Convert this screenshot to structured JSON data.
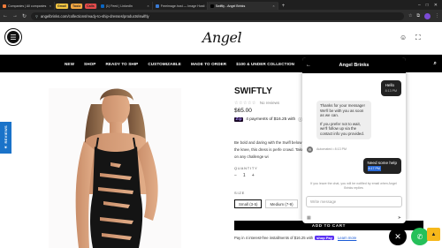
{
  "browser": {
    "tabs": [
      {
        "label": "Companies | All companies",
        "color": "#f07c3a",
        "active": false
      },
      {
        "label": "Gmail",
        "color": "#f4c542",
        "chip": true
      },
      {
        "label": "Toolz",
        "color": "#f4a742",
        "chip": true
      },
      {
        "label": "Calls",
        "color": "#e24a4a",
        "chip": true
      },
      {
        "label": "(1) Feed | LinkedIn",
        "color": "#0a66c2",
        "active": false
      },
      {
        "label": "Freeimage.host — Image Hosti",
        "color": "#3a7bd5",
        "active": false
      },
      {
        "label": "Swiftly - Angel Brinks",
        "color": "#000000",
        "active": true
      }
    ],
    "url": "angelbrinks.com/collections/ready-to-ship-dresses/products/swiftly"
  },
  "header": {
    "logo_text": "Angel Brinks",
    "menu_icon": "menu-icon",
    "user_icon": "user-icon",
    "cart_icon": "bag-icon"
  },
  "nav": {
    "items": [
      "NEW",
      "SHOP",
      "READY TO SHIP",
      "CUSTOMIZABLE",
      "MADE TO ORDER",
      "$100 & UNDER COLLECTION",
      "PLUS BAE"
    ]
  },
  "reviews_tab": {
    "label": "★ REVIEWS"
  },
  "product": {
    "title": "SWIFTLY",
    "stars": "☆☆☆☆☆",
    "reviews": "No reviews",
    "price": "$65.00",
    "zip_logo": "Zip",
    "zip_text": "4 payments of $16.25 with",
    "description": "Be bold and daring with the Swifl below the knee, this dress is perfe crowd. Take on any challenge wi",
    "quantity_label": "QUANTITY",
    "quantity": "1",
    "size_label": "SIZE",
    "sizes": [
      "Small (3-5)",
      "Medium (7-9)"
    ],
    "add_to_cart": "ADD TO CART",
    "shoppay_text": "Pay in 4 interest-free installments of $16.25 with",
    "shoppay_logo": "shop Pay",
    "learn_more": "Learn more"
  },
  "chat": {
    "title": "Angel Brinks",
    "messages": [
      {
        "from": "user",
        "text": "Hello",
        "time": "8:13 PM"
      },
      {
        "from": "bot",
        "paragraphs": [
          "Thanks for your message! We'll be with you as soon as we can.",
          "If you prefer not to wait, we'll follow up via the contact info you provided."
        ],
        "time": "Automated • 8:13 PM"
      },
      {
        "from": "user",
        "text": "Need some help",
        "time": "8:17 PM"
      }
    ],
    "notice": "If you leave the chat, you will be notified by email when Angel Brinks replies",
    "input_placeholder": "Write message"
  }
}
